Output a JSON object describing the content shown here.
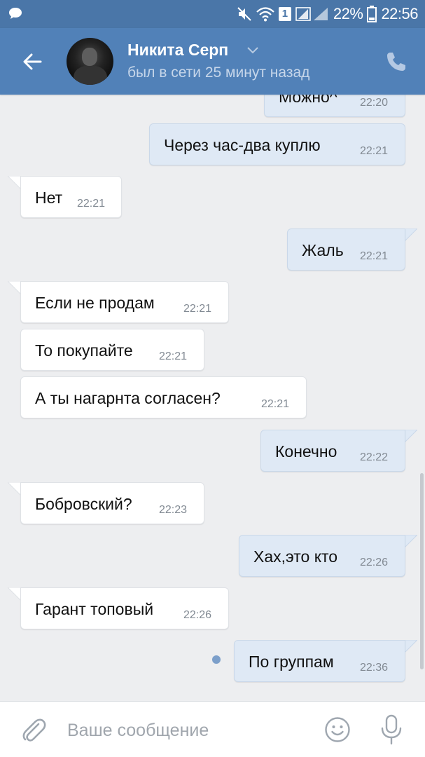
{
  "status_bar": {
    "battery": "22%",
    "time": "22:56",
    "sim_badge": "1"
  },
  "header": {
    "name": "Никита Серп",
    "status": "был в сети 25 минут назад"
  },
  "messages": [
    {
      "dir": "out",
      "text": "Можно^",
      "time": "22:20"
    },
    {
      "dir": "out",
      "text": "Через час-два куплю",
      "time": "22:21"
    },
    {
      "dir": "in",
      "text": "Нет",
      "time": "22:21"
    },
    {
      "dir": "out",
      "text": "Жаль",
      "time": "22:21"
    },
    {
      "dir": "in",
      "text": "Если не продам",
      "time": "22:21"
    },
    {
      "dir": "in",
      "text": "То покупайте",
      "time": "22:21"
    },
    {
      "dir": "in",
      "text": "А ты нагарнта согласен?",
      "time": "22:21"
    },
    {
      "dir": "out",
      "text": "Конечно",
      "time": "22:22"
    },
    {
      "dir": "in",
      "text": "Бобровский?",
      "time": "22:23"
    },
    {
      "dir": "out",
      "text": "Хах,это кто",
      "time": "22:26"
    },
    {
      "dir": "in",
      "text": "Гарант топовый",
      "time": "22:26"
    },
    {
      "dir": "out",
      "text": "По группам",
      "time": "22:36"
    }
  ],
  "input": {
    "placeholder": "Ваше сообщение"
  },
  "icons": {
    "back": "arrow-left-icon",
    "call": "phone-icon",
    "attach": "paperclip-icon",
    "emoji": "smiley-icon",
    "mic": "microphone-icon"
  },
  "colors": {
    "header": "#5181b8",
    "status_bar": "#4a76a8",
    "incoming_bubble": "#ffffff",
    "outgoing_bubble": "#dfe9f5",
    "background": "#edeef0"
  }
}
